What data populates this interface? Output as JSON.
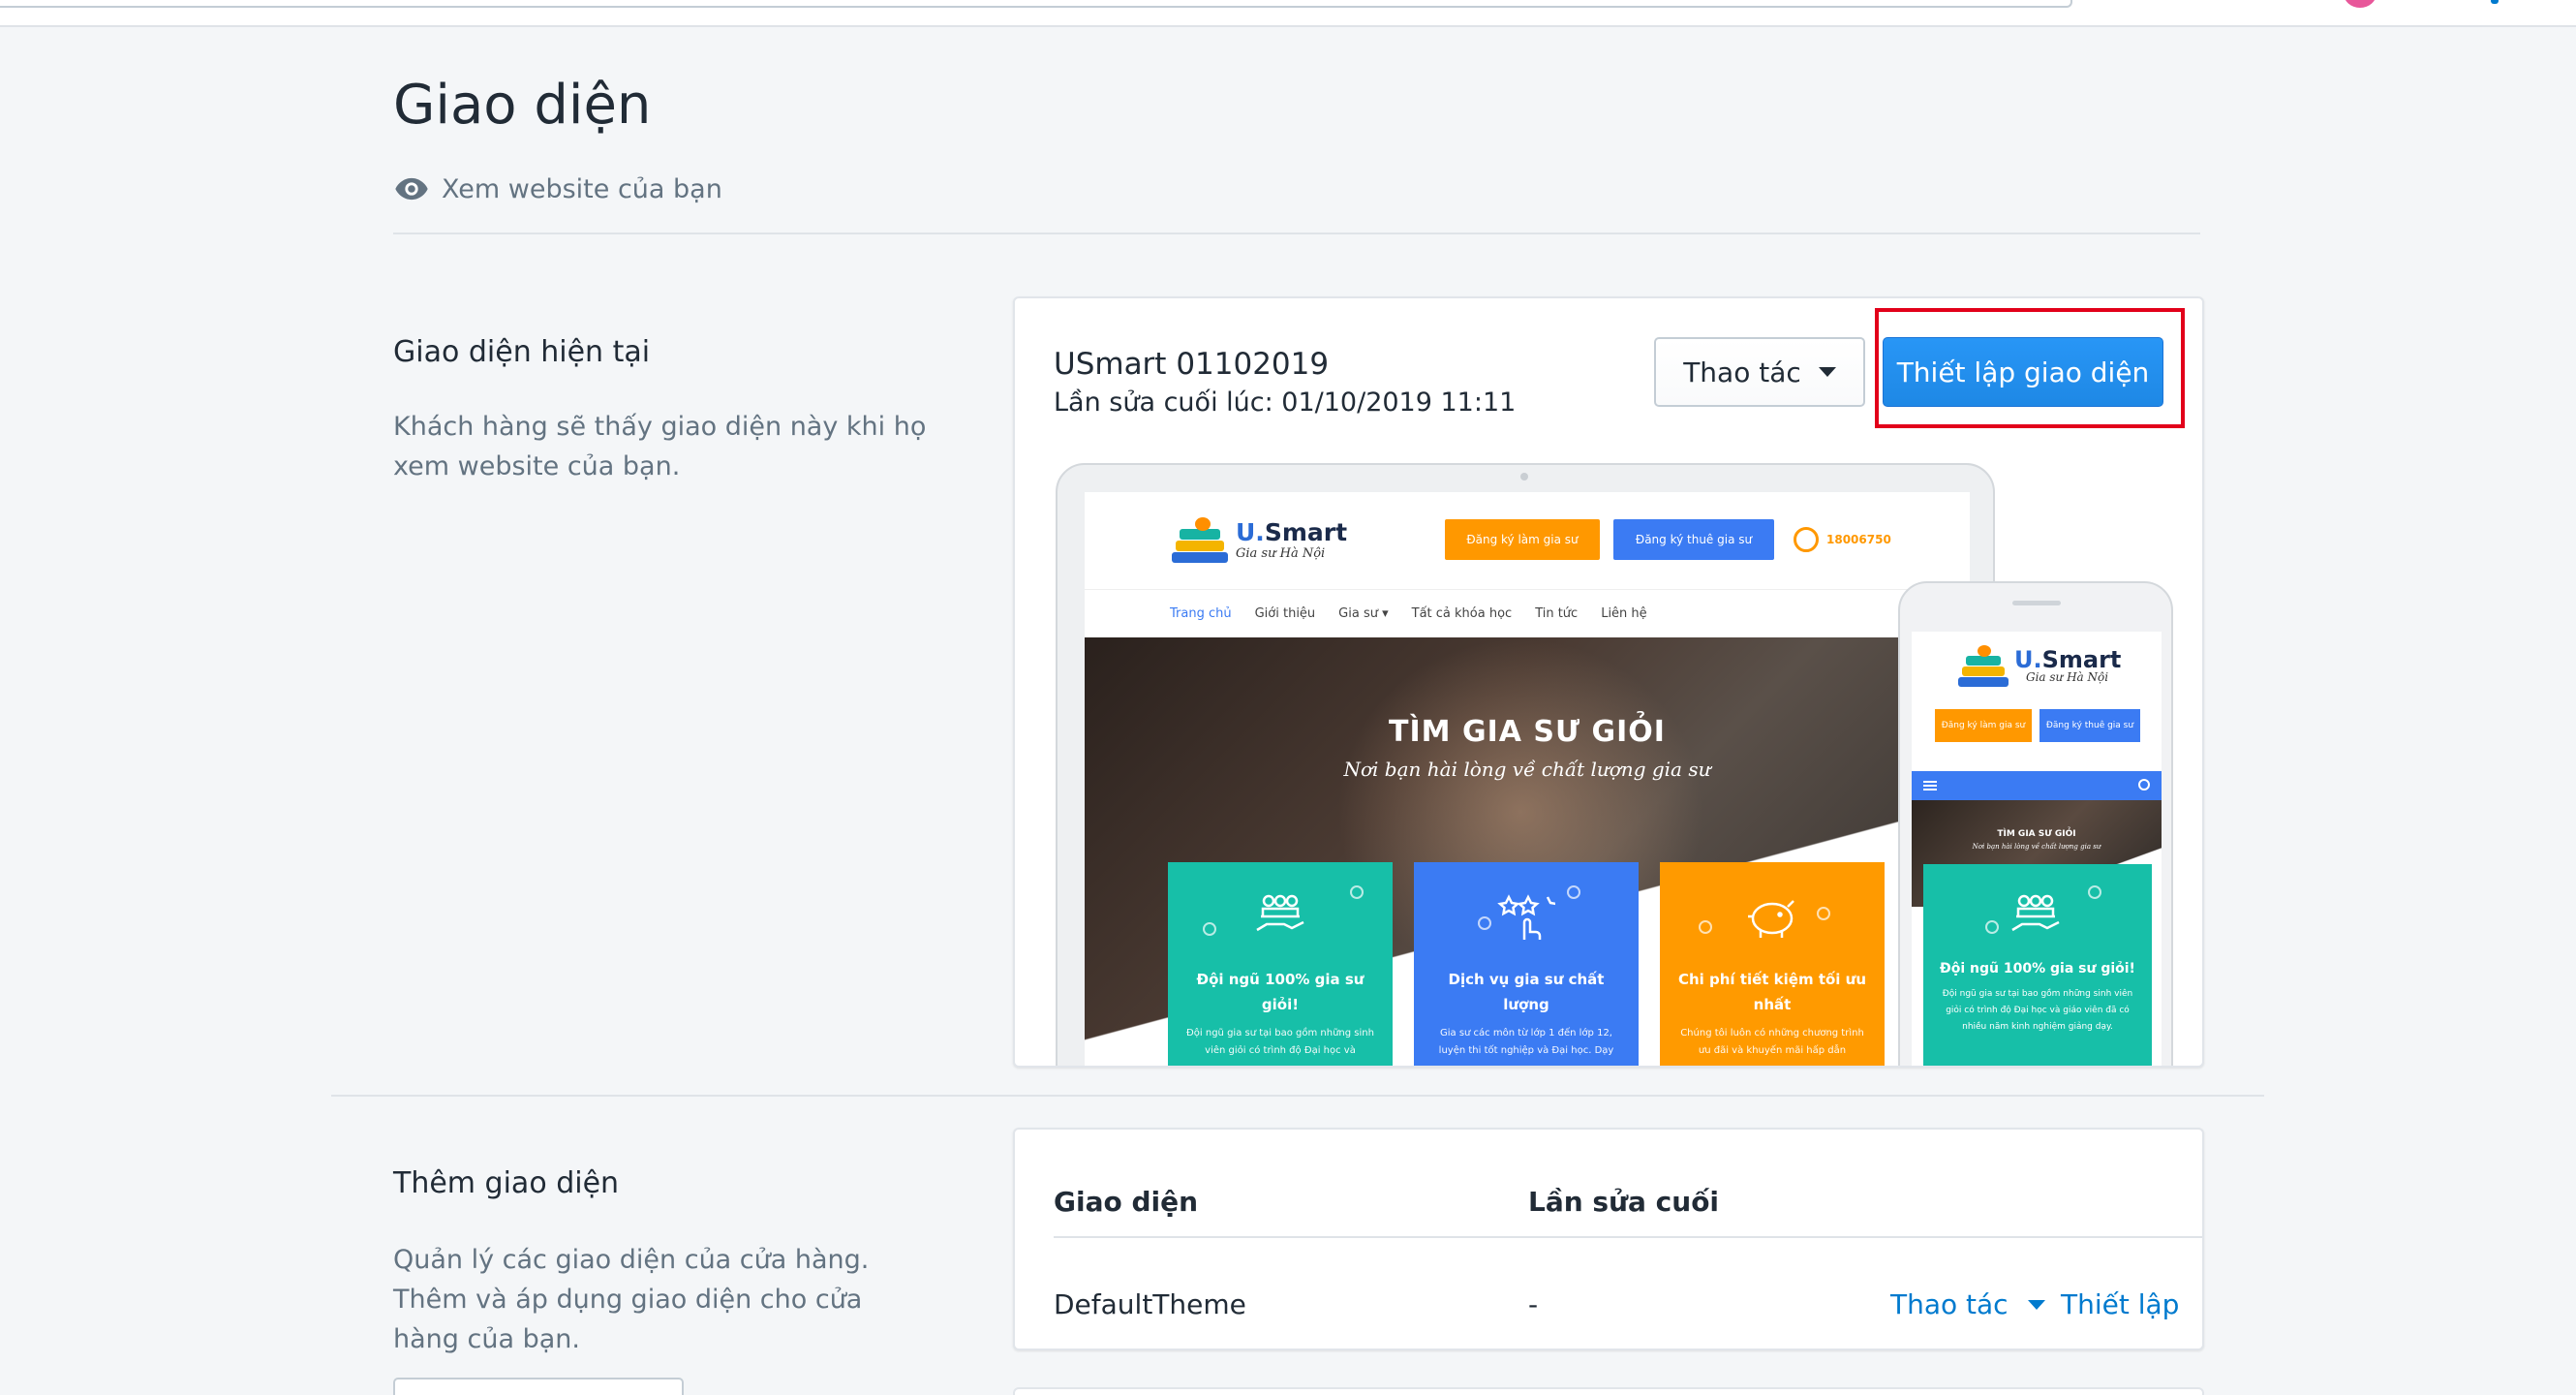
{
  "page": {
    "title": "Giao diện",
    "view_website": "Xem website của bạn"
  },
  "current_theme_section": {
    "title": "Giao diện hiện tại",
    "description": "Khách hàng sẽ thấy giao diện này khi họ xem website của bạn.",
    "theme_name": "USmart 01102019",
    "last_edited": "Lần sửa cuối lúc: 01/10/2019 11:11",
    "actions_label": "Thao tác",
    "customize_label": "Thiết lập giao diện",
    "highlight_color": "#e2001a"
  },
  "preview": {
    "brand_prefix": "U.",
    "brand_suffix": "Smart",
    "slogan": "Gia sư Hà Nội",
    "header_btn_register_tutor": "Đăng ký làm gia sư",
    "header_btn_hire_tutor": "Đăng ký thuê gia sư",
    "phone": "18006750",
    "nav": [
      "Trang chủ",
      "Giới thiệu",
      "Gia sư ▾",
      "Tất cả khóa học",
      "Tin tức",
      "Liên hệ"
    ],
    "hero_title": "TÌM GIA SƯ GIỎI",
    "hero_subtitle": "Nơi bạn hài lòng về chất lượng gia sư",
    "features": [
      {
        "title": "Đội ngũ 100% gia sư giỏi!",
        "desc": "Đội ngũ gia sư tại bao gồm những sinh viên giỏi có trình độ Đại học và",
        "color": "#17bfa8"
      },
      {
        "title": "Dịch vụ gia sư chất lượng",
        "desc": "Gia sư các môn từ lớp 1 đến lớp 12, luyện thi tốt nghiệp và Đại học. Dạy",
        "color": "#3b7bf3"
      },
      {
        "title": "Chi phí tiết kiệm tối ưu nhất",
        "desc": "Chúng tôi luôn có những chương trình ưu đãi và khuyến mãi hấp dẫn",
        "color": "#ff9a00"
      }
    ],
    "mobile_hero_title": "TÌM GIA SƯ GIỎI",
    "mobile_hero_subtitle": "Nơi bạn hài lòng về chất lượng gia sư",
    "mobile_feature_title": "Đội ngũ 100% gia sư giỏi!",
    "mobile_feature_desc": "Đội ngũ gia sư tại bao gồm những sinh viên giỏi có trình độ Đại học và giáo viên đã có nhiều năm kinh nghiệm giảng dạy."
  },
  "add_theme_section": {
    "title": "Thêm giao diện",
    "description_line1": "Quản lý các giao diện của cửa hàng.",
    "description_line2": "Thêm và áp dụng giao diện cho cửa hàng của bạn.",
    "table": {
      "col_theme": "Giao diện",
      "col_last_edit": "Lần sửa cuối",
      "rows": [
        {
          "name": "DefaultTheme",
          "last_edit": "-",
          "actions_label": "Thao tác",
          "setup_label": "Thiết lập"
        }
      ]
    }
  },
  "colors": {
    "primary": "#1e88e5",
    "link": "#007ace",
    "text": "#212b36",
    "muted": "#637381"
  }
}
